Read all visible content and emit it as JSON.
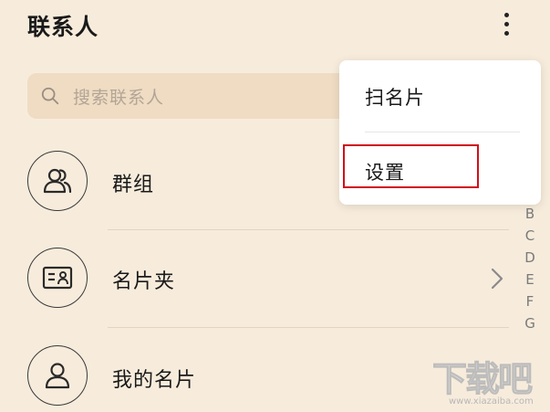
{
  "header": {
    "title": "联系人",
    "menu_icon": "more-vertical-icon"
  },
  "search": {
    "placeholder": "搜索联系人",
    "icon": "search-icon"
  },
  "list": [
    {
      "label": "群组",
      "icon": "group-icon"
    },
    {
      "label": "名片夹",
      "icon": "card-holder-icon",
      "has_chevron": true
    },
    {
      "label": "我的名片",
      "icon": "person-icon"
    }
  ],
  "index_letters": [
    "B",
    "C",
    "D",
    "E",
    "F",
    "G"
  ],
  "popup_menu": {
    "items": [
      {
        "label": "扫名片"
      },
      {
        "label": "设置",
        "highlighted": true
      }
    ]
  },
  "watermark": {
    "text": "下载吧",
    "url": "www.xiazaiba.com"
  },
  "colors": {
    "background": "#f7ecdc",
    "search_bg": "#efdcc3",
    "highlight_border": "#d0101a",
    "menu_bg": "#ffffff"
  }
}
